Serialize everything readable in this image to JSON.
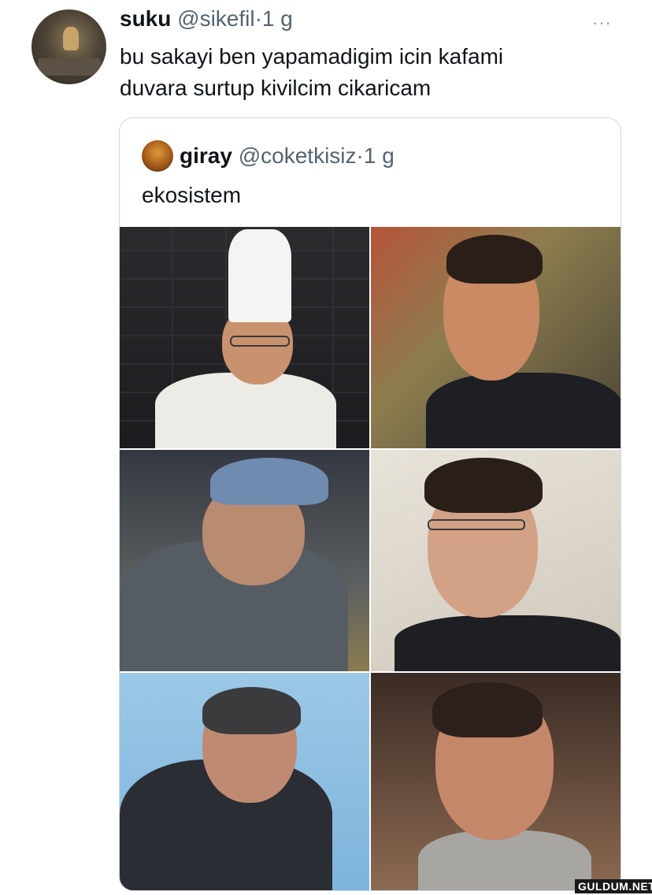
{
  "tweet": {
    "author_name": "suku",
    "handle": "@sikefil",
    "separator": "·",
    "time": "1 g",
    "more": "···",
    "text_line1": "bu sakayi ben yapamadigim icin kafami",
    "text_line2": "duvara surtup kivilcim cikaricam"
  },
  "quoted": {
    "author_name": "giray",
    "handle": "@coketkisiz",
    "separator": "·",
    "time": "1 g",
    "text": "ekosistem",
    "photo_count": 6
  },
  "watermark": "GULDUM.NET"
}
